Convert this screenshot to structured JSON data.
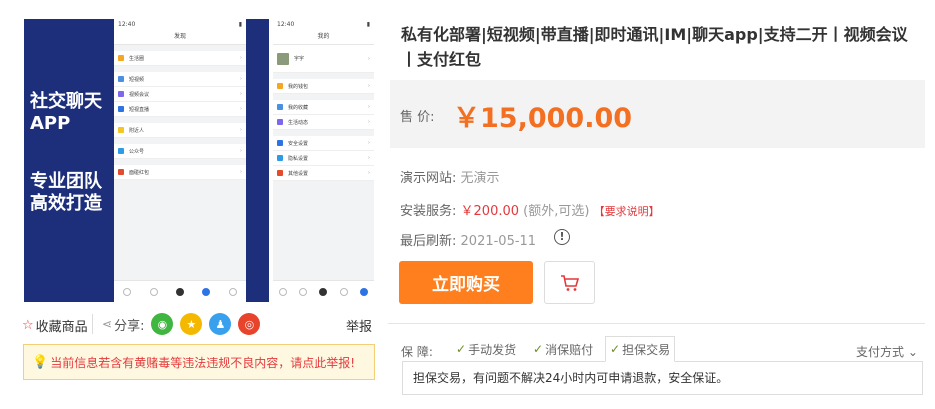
{
  "banner": {
    "line1": "社交聊天",
    "line2": "APP",
    "line3": "专业团队",
    "line4": "高效打造",
    "phone1": {
      "time": "12:40",
      "title": "发现",
      "rows": [
        "生活圈",
        "短视频",
        "视频会议",
        "短视直播",
        "附近人",
        "公众号",
        "面碰红包"
      ]
    },
    "phone2": {
      "time": "12:40",
      "title": "我的",
      "user": "宇宇",
      "rows": [
        "我的钱包",
        "我的收藏",
        "生活动态",
        "安全设置",
        "隐私设置",
        "其他设置"
      ]
    }
  },
  "actions": {
    "favorite": "收藏商品",
    "share_label": "分享:",
    "report": "举报"
  },
  "warning": "当前信息若含有黄赌毒等违法违规不良内容，请点此举报!",
  "product": {
    "title": "私有化部署|短视频|带直播|即时通讯|IM|聊天app|支持二开丨视频会议丨支付红包",
    "price_label": "售 价:",
    "price": "￥15,000.00",
    "demo_label": "演示网站:",
    "demo_value": "无演示",
    "install_label": "安装服务:",
    "install_price": "￥200.00",
    "install_note": "(额外,可选)",
    "install_req": "【要求说明】",
    "refresh_label": "最后刷新:",
    "refresh_date": "2021-05-11",
    "buy_label": "立即购买"
  },
  "guarantee": {
    "label": "保 障:",
    "items": [
      "手动发货",
      "消保赔付",
      "担保交易"
    ],
    "pay_method": "支付方式",
    "desc": "担保交易，有问题不解决24小时内可申请退款，安全保证。"
  },
  "colors": {
    "accent": "#ff7f1e",
    "price": "#f36f21",
    "red": "#e4393c",
    "banner": "#1d2f7b"
  }
}
